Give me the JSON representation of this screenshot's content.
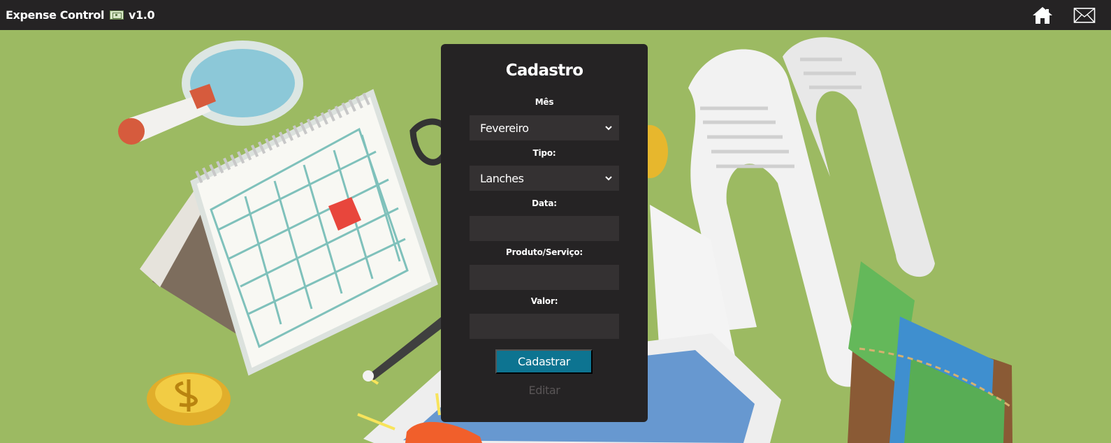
{
  "app": {
    "title": "Expense Control",
    "version": "v1.0",
    "nav_icons": [
      "home-icon",
      "mail-icon"
    ]
  },
  "form": {
    "title": "Cadastro",
    "month": {
      "label": "Mês",
      "value": "Fevereiro"
    },
    "type": {
      "label": "Tipo:",
      "value": "Lanches"
    },
    "date": {
      "label": "Data:",
      "value": ""
    },
    "product": {
      "label": "Produto/Serviço:",
      "value": ""
    },
    "amount": {
      "label": "Valor:",
      "value": ""
    },
    "submit_label": "Cadastrar",
    "edit_label": "Editar"
  },
  "colors": {
    "background": "#9cba62",
    "panel": "#252324",
    "field": "#343132",
    "button": "#0d7491",
    "muted": "#595556"
  }
}
